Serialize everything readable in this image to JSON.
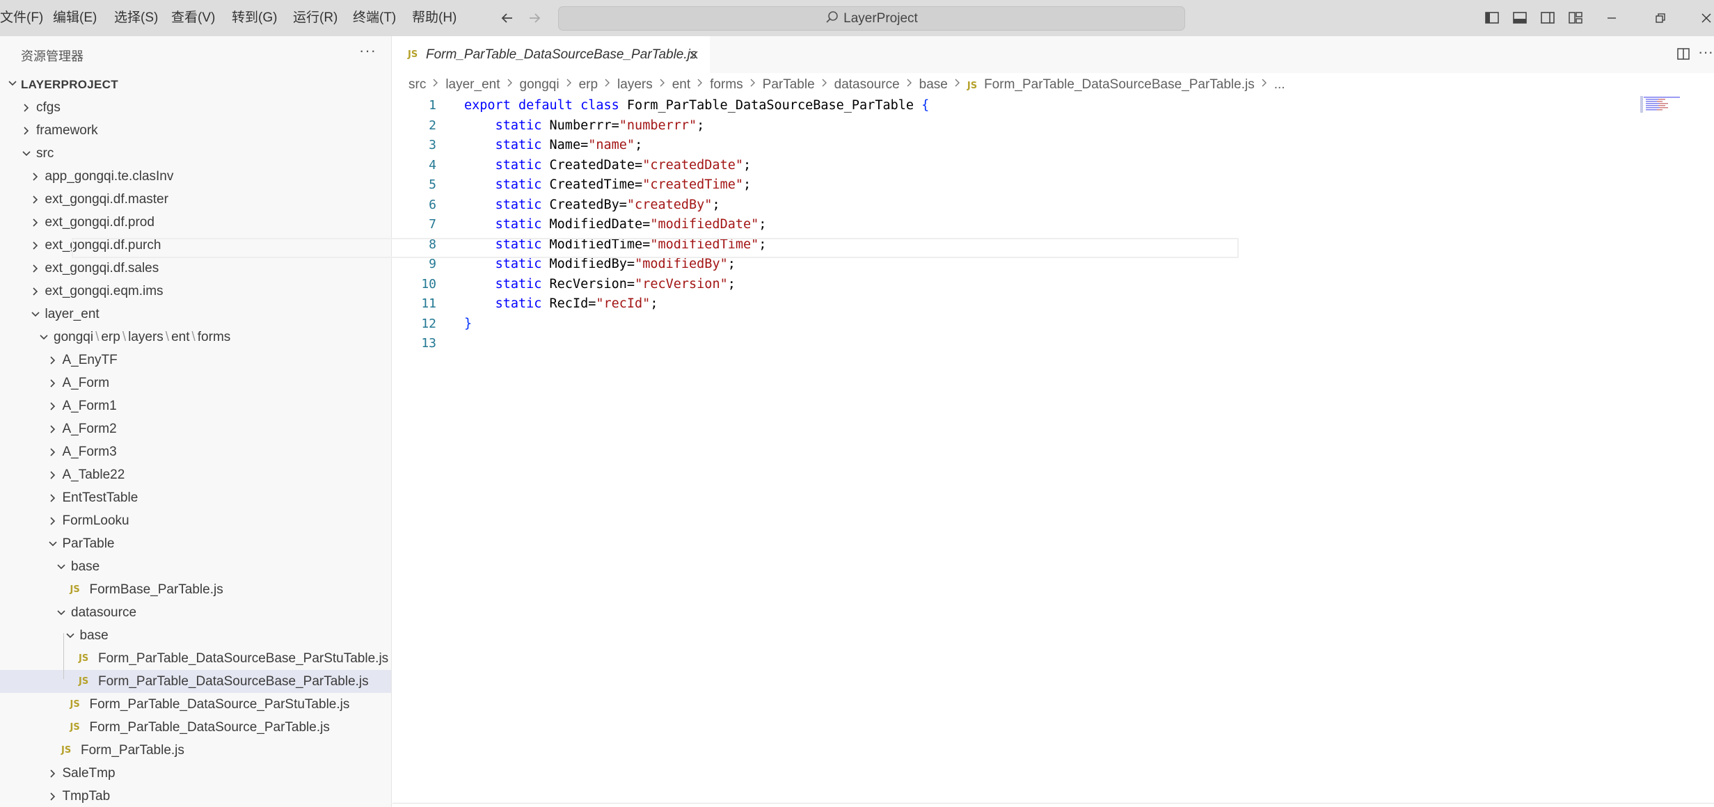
{
  "menu": [
    {
      "label": "文件(F)"
    },
    {
      "label": "编辑(E)"
    },
    {
      "label": "选择(S)"
    },
    {
      "label": "查看(V)"
    },
    {
      "label": "转到(G)"
    },
    {
      "label": "运行(R)"
    },
    {
      "label": "终端(T)"
    },
    {
      "label": "帮助(H)"
    }
  ],
  "search": {
    "text": "LayerProject"
  },
  "sidebar": {
    "title": "资源管理器",
    "more": "···",
    "project": "LAYERPROJECT",
    "tree": [
      {
        "label": "cfgs",
        "depth": 0,
        "type": "folder",
        "expanded": false
      },
      {
        "label": "framework",
        "depth": 0,
        "type": "folder",
        "expanded": false
      },
      {
        "label": "src",
        "depth": 0,
        "type": "folder",
        "expanded": true
      },
      {
        "label": "app_gongqi.te.clasInv",
        "depth": 1,
        "type": "folder",
        "expanded": false
      },
      {
        "label": "ext_gongqi.df.master",
        "depth": 1,
        "type": "folder",
        "expanded": false
      },
      {
        "label": "ext_gongqi.df.prod",
        "depth": 1,
        "type": "folder",
        "expanded": false
      },
      {
        "label": "ext_gongqi.df.purch",
        "depth": 1,
        "type": "folder",
        "expanded": false
      },
      {
        "label": "ext_gongqi.df.sales",
        "depth": 1,
        "type": "folder",
        "expanded": false
      },
      {
        "label": "ext_gongqi.eqm.ims",
        "depth": 1,
        "type": "folder",
        "expanded": false
      },
      {
        "label": "layer_ent",
        "depth": 1,
        "type": "folder",
        "expanded": true
      },
      {
        "label": "gongqi",
        "depth": 2,
        "type": "folder",
        "expanded": true,
        "compact": [
          "erp",
          "layers",
          "ent",
          "forms"
        ]
      },
      {
        "label": "A_EnyTF",
        "depth": 3,
        "type": "folder",
        "expanded": false
      },
      {
        "label": "A_Form",
        "depth": 3,
        "type": "folder",
        "expanded": false
      },
      {
        "label": "A_Form1",
        "depth": 3,
        "type": "folder",
        "expanded": false
      },
      {
        "label": "A_Form2",
        "depth": 3,
        "type": "folder",
        "expanded": false
      },
      {
        "label": "A_Form3",
        "depth": 3,
        "type": "folder",
        "expanded": false
      },
      {
        "label": "A_Table22",
        "depth": 3,
        "type": "folder",
        "expanded": false
      },
      {
        "label": "EntTestTable",
        "depth": 3,
        "type": "folder",
        "expanded": false
      },
      {
        "label": "FormLooku",
        "depth": 3,
        "type": "folder",
        "expanded": false
      },
      {
        "label": "ParTable",
        "depth": 3,
        "type": "folder",
        "expanded": true
      },
      {
        "label": "base",
        "depth": 4,
        "type": "folder",
        "expanded": true
      },
      {
        "label": "FormBase_ParTable.js",
        "depth": 5,
        "type": "file"
      },
      {
        "label": "datasource",
        "depth": 4,
        "type": "folder",
        "expanded": true
      },
      {
        "label": "base",
        "depth": 5,
        "type": "folder",
        "expanded": true
      },
      {
        "label": "Form_ParTable_DataSourceBase_ParStuTable.js",
        "depth": 6,
        "type": "file"
      },
      {
        "label": "Form_ParTable_DataSourceBase_ParTable.js",
        "depth": 6,
        "type": "file",
        "selected": true
      },
      {
        "label": "Form_ParTable_DataSource_ParStuTable.js",
        "depth": 5,
        "type": "file"
      },
      {
        "label": "Form_ParTable_DataSource_ParTable.js",
        "depth": 5,
        "type": "file"
      },
      {
        "label": "Form_ParTable.js",
        "depth": 4,
        "type": "file"
      },
      {
        "label": "SaleTmp",
        "depth": 3,
        "type": "folder",
        "expanded": false
      },
      {
        "label": "TmpTab",
        "depth": 3,
        "type": "folder",
        "expanded": false
      }
    ]
  },
  "tab": {
    "label": "Form_ParTable_DataSourceBase_ParTable.js",
    "badge": "JS"
  },
  "breadcrumb": [
    "src",
    "layer_ent",
    "gongqi",
    "erp",
    "layers",
    "ent",
    "forms",
    "ParTable",
    "datasource",
    "base"
  ],
  "breadcrumb_file": "Form_ParTable_DataSourceBase_ParTable.js",
  "breadcrumb_tail": "...",
  "code": [
    [
      [
        "kw",
        "export default class "
      ],
      [
        "t",
        "Form_ParTable_DataSourceBase_ParTable "
      ],
      [
        "brace",
        "{"
      ]
    ],
    [
      [
        "t",
        "    "
      ],
      [
        "kw",
        "static "
      ],
      [
        "t",
        "Numberrr="
      ],
      [
        "str",
        "\"numberrr\""
      ],
      [
        "t",
        ";"
      ]
    ],
    [
      [
        "t",
        "    "
      ],
      [
        "kw",
        "static "
      ],
      [
        "t",
        "Name="
      ],
      [
        "str",
        "\"name\""
      ],
      [
        "t",
        ";"
      ]
    ],
    [
      [
        "t",
        "    "
      ],
      [
        "kw",
        "static "
      ],
      [
        "t",
        "CreatedDate="
      ],
      [
        "str",
        "\"createdDate\""
      ],
      [
        "t",
        ";"
      ]
    ],
    [
      [
        "t",
        "    "
      ],
      [
        "kw",
        "static "
      ],
      [
        "t",
        "CreatedTime="
      ],
      [
        "str",
        "\"createdTime\""
      ],
      [
        "t",
        ";"
      ]
    ],
    [
      [
        "t",
        "    "
      ],
      [
        "kw",
        "static "
      ],
      [
        "t",
        "CreatedBy="
      ],
      [
        "str",
        "\"createdBy\""
      ],
      [
        "t",
        ";"
      ]
    ],
    [
      [
        "t",
        "    "
      ],
      [
        "kw",
        "static "
      ],
      [
        "t",
        "ModifiedDate="
      ],
      [
        "str",
        "\"modifiedDate\""
      ],
      [
        "t",
        ";"
      ]
    ],
    [
      [
        "t",
        "    "
      ],
      [
        "kw",
        "static "
      ],
      [
        "t",
        "ModifiedTime="
      ],
      [
        "str",
        "\"modifiedTime\""
      ],
      [
        "t",
        ";"
      ]
    ],
    [
      [
        "t",
        "    "
      ],
      [
        "kw",
        "static "
      ],
      [
        "t",
        "ModifiedBy="
      ],
      [
        "str",
        "\"modifiedBy\""
      ],
      [
        "t",
        ";"
      ]
    ],
    [
      [
        "t",
        "    "
      ],
      [
        "kw",
        "static "
      ],
      [
        "t",
        "RecVersion="
      ],
      [
        "str",
        "\"recVersion\""
      ],
      [
        "t",
        ";"
      ]
    ],
    [
      [
        "t",
        "    "
      ],
      [
        "kw",
        "static "
      ],
      [
        "t",
        "RecId="
      ],
      [
        "str",
        "\"recId\""
      ],
      [
        "t",
        ";"
      ]
    ],
    [
      [
        "brace",
        "}"
      ]
    ],
    []
  ],
  "colors": {
    "keyword": "#0000ff",
    "string": "#a31515",
    "line_number": "#237893",
    "selection": "#e4e6f1",
    "js_badge": "#b5a12a"
  }
}
